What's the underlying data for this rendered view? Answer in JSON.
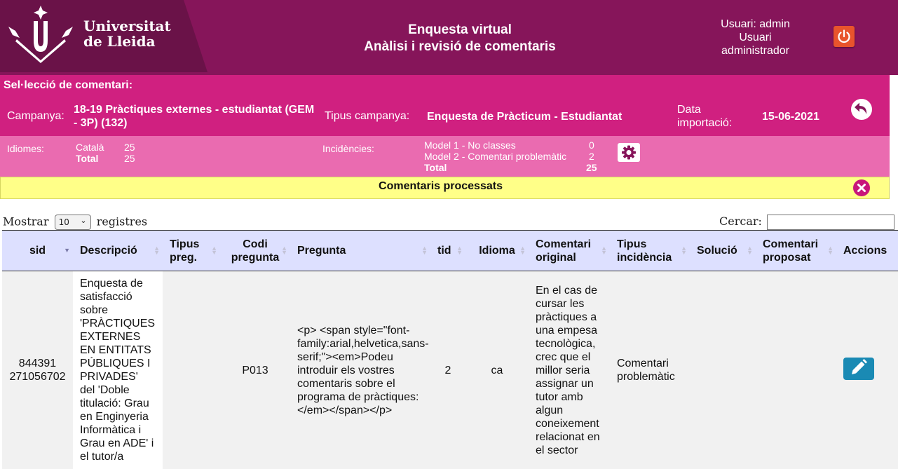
{
  "header": {
    "logo_line1": "Universitat",
    "logo_line2": "de Lleida",
    "title_line1": "Enquesta virtual",
    "title_line2": "Anàlisi i revisió de comentaris",
    "user_line1": "Usuari: admin",
    "user_line2": "Usuari",
    "user_line3": "administrador"
  },
  "selection": {
    "heading": "Sel·lecció de comentari:",
    "campaign_label": "Campanya:",
    "campaign_value": "18-19 Pràctiques externes - estudiantat (GEM - 3P) (132)",
    "type_label": "Tipus campanya:",
    "type_value": "Enquesta de Pràcticum - Estudiantat",
    "date_label": "Data importació:",
    "date_value": "15-06-2021"
  },
  "info": {
    "languages_label": "Idiomes:",
    "languages": [
      {
        "name": "Català",
        "count": "25"
      },
      {
        "name": "Total",
        "count": "25"
      }
    ],
    "incidents_label": "Incidències:",
    "incidents": [
      {
        "name": "Model 1 - No classes",
        "count": "0"
      },
      {
        "name": "Model 2 - Comentari problemàtic",
        "count": "2"
      },
      {
        "name": "Total",
        "count": "25"
      }
    ]
  },
  "banner": {
    "text": "Comentaris processats"
  },
  "table_controls": {
    "show_label": "Mostrar",
    "page_size": "10",
    "records_label": "registres",
    "search_label": "Cercar:",
    "search_value": ""
  },
  "table": {
    "columns": [
      "sid",
      "Descripció",
      "Tipus preg.",
      "Codi pregunta",
      "Pregunta",
      "tid",
      "Idioma",
      "Comentari original",
      "Tipus incidència",
      "Solució",
      "Comentari proposat",
      "Accions"
    ],
    "rows": [
      {
        "sid": "844391 271056702",
        "descripcio": "Enquesta de satisfacció sobre 'PRÀCTIQUES EXTERNES EN ENTITATS PÚBLIQUES I PRIVADES' del 'Doble titulació: Grau en Enginyeria Informàtica i Grau en ADE' i el tutor/a",
        "tipus_preg": "",
        "codi_pregunta": "P013",
        "pregunta": "<p> <span style=\"font-family:arial,helvetica,sans-serif;\"><em>Podeu introduir els vostres comentaris sobre el programa de pràctiques: </em></span></p>",
        "tid": "2",
        "idioma": "ca",
        "comentari_original": "En el cas de cursar les pràctiques a una empesa tecnològica, crec que el millor seria assignar un tutor amb algun coneixement relacionat en el sector",
        "tipus_incidencia": "Comentari problemàtic",
        "solucio": "",
        "comentari_proposat": ""
      }
    ]
  },
  "colors": {
    "header": "#86155a",
    "selection": "#d02080",
    "info": "#ea6bb0",
    "banner": "#ffff88",
    "table_header": "#dde0ff"
  }
}
